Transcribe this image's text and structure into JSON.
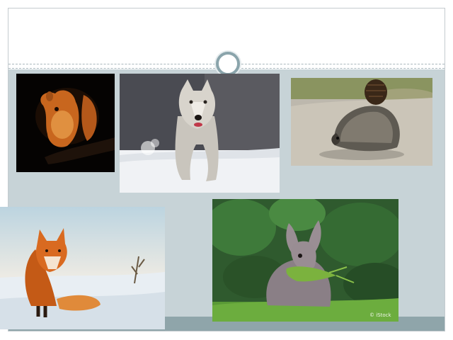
{
  "slide": {
    "photos": [
      {
        "subject": "squirrel",
        "background": "#050302"
      },
      {
        "subject": "wolf",
        "background": "#4a4b52"
      },
      {
        "subject": "hedgehog",
        "background": "#bdb8ad"
      },
      {
        "subject": "fox",
        "background": "#dbe6ec"
      },
      {
        "subject": "rabbit",
        "background": "#2f5a2e"
      }
    ],
    "watermark": "© iStock"
  },
  "colors": {
    "slide_bg": "#c7d3d7",
    "accent": "#8aa4ab",
    "strip": "#8fa5aa"
  }
}
